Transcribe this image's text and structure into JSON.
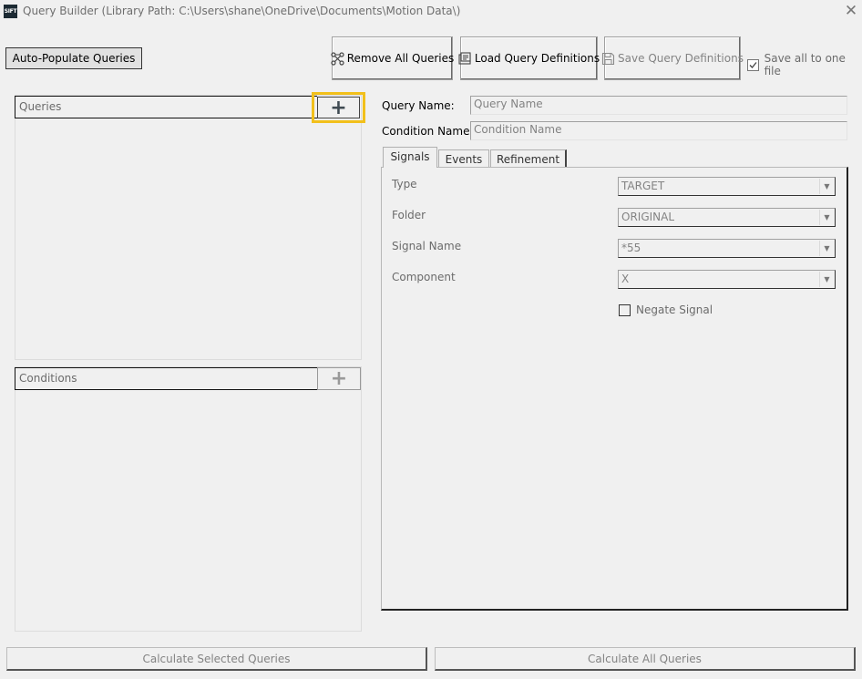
{
  "window": {
    "logo_text": "SIFT",
    "title": "Query Builder (Library Path: C:\\Users\\shane\\OneDrive\\Documents\\Motion Data\\)",
    "close_glyph": "✕"
  },
  "toolbar": {
    "auto_populate_label": "Auto-Populate Queries",
    "remove_all_label": "Remove All Queries",
    "load_label": "Load Query Definitions",
    "save_label": "Save Query Definitions",
    "save_one_file_label": "Save all to one file",
    "save_one_file_checked": true
  },
  "queries_panel": {
    "header": "Queries",
    "add_glyph": "+"
  },
  "conditions_panel": {
    "header": "Conditions",
    "add_glyph": "+"
  },
  "details": {
    "query_name_label": "Query Name:",
    "query_name_placeholder": "Query Name",
    "condition_name_label": "Condition Name:",
    "condition_name_placeholder": "Condition Name"
  },
  "tabs": [
    {
      "label": "Signals",
      "active": true
    },
    {
      "label": "Events",
      "active": false
    },
    {
      "label": "Refinement",
      "active": false
    }
  ],
  "signals_form": {
    "type_label": "Type",
    "type_value": "TARGET",
    "folder_label": "Folder",
    "folder_value": "ORIGINAL",
    "signal_name_label": "Signal Name",
    "signal_name_value": "*55",
    "component_label": "Component",
    "component_value": "X",
    "negate_label": "Negate Signal",
    "negate_checked": false
  },
  "footer": {
    "calc_selected_label": "Calculate Selected Queries",
    "calc_all_label": "Calculate All Queries"
  },
  "colors": {
    "highlight": "#f2c01b",
    "window_bg": "#f0f0f0",
    "disabled_text": "#838383"
  }
}
